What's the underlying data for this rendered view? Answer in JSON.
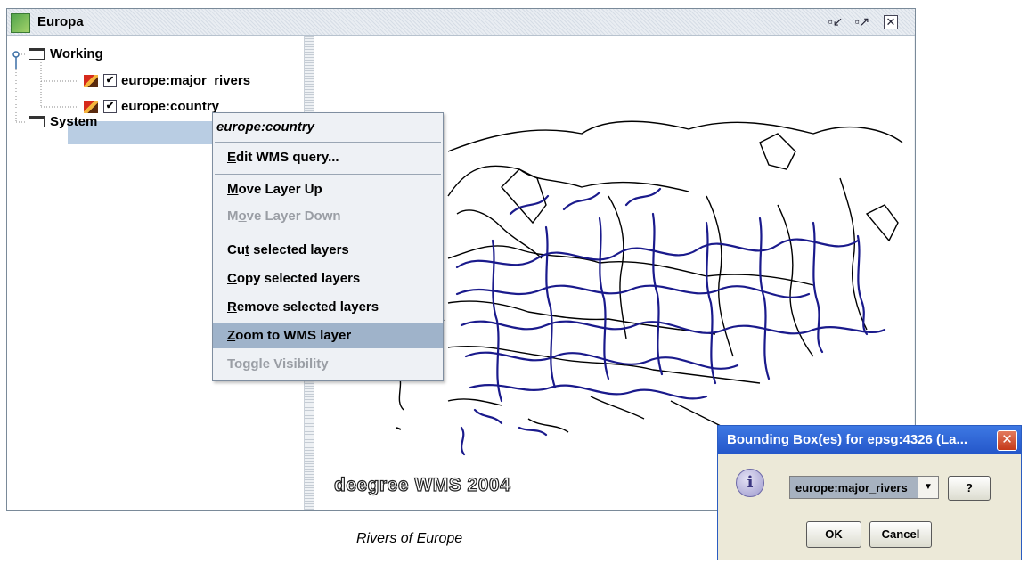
{
  "window": {
    "title": "Europa",
    "controls": [
      "restore-icon",
      "maximize-icon",
      "close-icon"
    ]
  },
  "tree": {
    "groups": [
      {
        "label": "Working",
        "expanded": true
      },
      {
        "label": "System",
        "expanded": false
      }
    ],
    "layers": [
      {
        "label": "europe:major_rivers",
        "checked": true,
        "selected": false
      },
      {
        "label": "europe:country",
        "checked": true,
        "selected": true
      }
    ]
  },
  "context_menu": {
    "title": "europe:country",
    "items": [
      {
        "pre": "",
        "mnemonic": "E",
        "post": "dit WMS query...",
        "enabled": true
      },
      {
        "pre": "",
        "mnemonic": "M",
        "post": "ove Layer Up",
        "enabled": true
      },
      {
        "pre": "M",
        "mnemonic": "o",
        "post": "ve Layer Down",
        "enabled": false
      },
      {
        "pre": "Cu",
        "mnemonic": "t",
        "post": " selected layers",
        "enabled": true
      },
      {
        "pre": "",
        "mnemonic": "C",
        "post": "opy selected layers",
        "enabled": true
      },
      {
        "pre": "",
        "mnemonic": "R",
        "post": "emove selected layers",
        "enabled": true
      },
      {
        "pre": "",
        "mnemonic": "Z",
        "post": "oom to WMS layer",
        "enabled": true,
        "highlighted": true
      },
      {
        "pre": "To",
        "mnemonic": "g",
        "post": "gle Visibility",
        "enabled": false
      }
    ]
  },
  "map": {
    "watermark": "deegree WMS 2004",
    "country_outline_color": "#000000",
    "river_color": "#1a1a8c"
  },
  "caption": "Rivers of Europe",
  "dialog": {
    "title": "Bounding Box(es) for epsg:4326 (La...",
    "icon": "info-icon",
    "combo_value": "europe:major_rivers",
    "help_label": "?",
    "ok_label": "OK",
    "cancel_label": "Cancel"
  }
}
